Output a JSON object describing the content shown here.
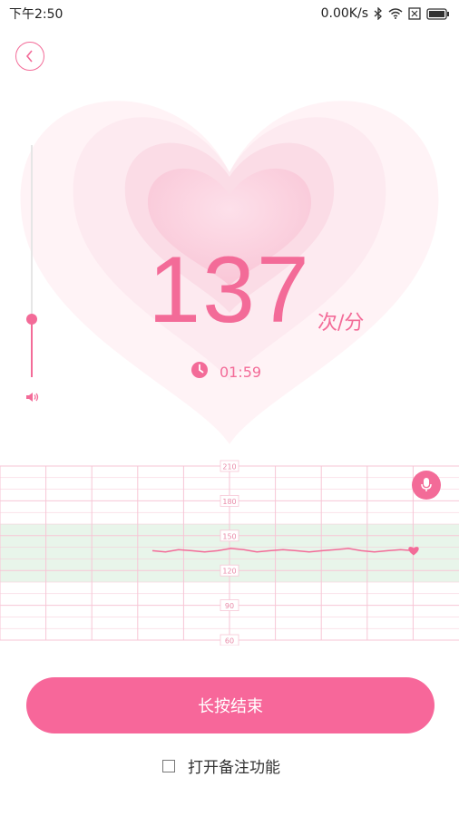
{
  "status_bar": {
    "time": "下午2:50",
    "network_speed": "0.00K/s",
    "icons": [
      "bluetooth-icon",
      "wifi-icon",
      "sim-icon",
      "battery-icon"
    ]
  },
  "back_button": {
    "icon": "chevron-left-icon"
  },
  "heart_rate": {
    "value": "137",
    "unit": "次/分"
  },
  "timer": {
    "icon": "clock-icon",
    "value": "01:59"
  },
  "volume": {
    "level_fraction": 0.25,
    "icon": "speaker-icon"
  },
  "chart_data": {
    "type": "line",
    "y_tick_labels": [
      "210",
      "180",
      "150",
      "120",
      "90",
      "60"
    ],
    "normal_band": [
      110,
      160
    ],
    "ylim": [
      60,
      210
    ],
    "series": [
      {
        "values": [
          137,
          136,
          138,
          137,
          136,
          137,
          139,
          138,
          136,
          137,
          138,
          137,
          136,
          137,
          138,
          139,
          137,
          136,
          137,
          138,
          137
        ]
      }
    ]
  },
  "mic_button": {
    "icon": "microphone-icon"
  },
  "end_button": {
    "label": "长按结束"
  },
  "note_toggle": {
    "label": "打开备注功能",
    "checked": false
  },
  "colors": {
    "accent": "#f36b98",
    "heart_light": "#fde6ee",
    "band": "#e8f5ea",
    "grid": "#f7c6d6"
  }
}
